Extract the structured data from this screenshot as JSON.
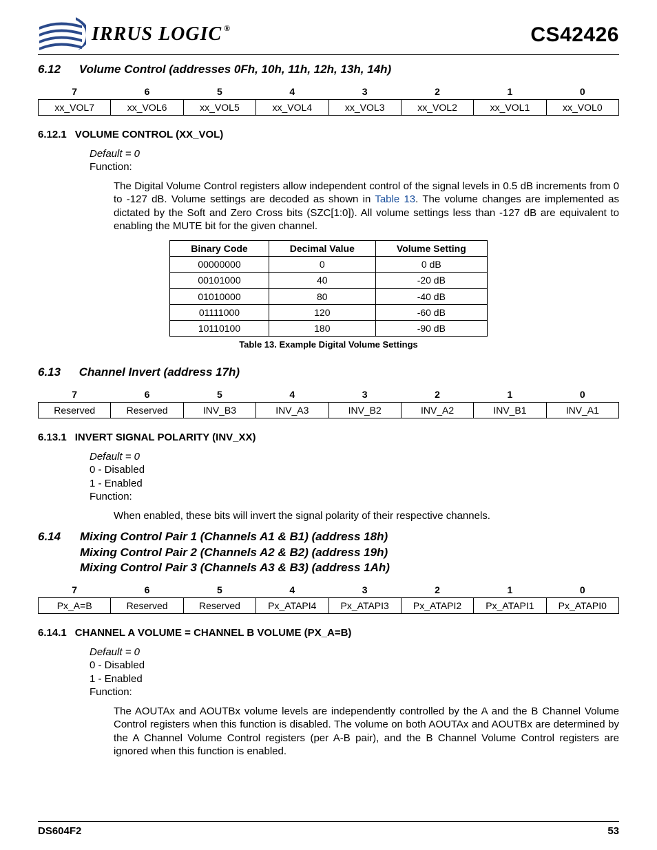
{
  "header": {
    "logo_text": "IRRUS LOGIC",
    "reg_mark": "®",
    "part_number": "CS42426"
  },
  "section612": {
    "number": "6.12",
    "title": "Volume Control (addresses 0Fh, 10h, 11h, 12h, 13h, 14h)",
    "bit_headers": [
      "7",
      "6",
      "5",
      "4",
      "3",
      "2",
      "1",
      "0"
    ],
    "bit_cells": [
      "xx_VOL7",
      "xx_VOL6",
      "xx_VOL5",
      "xx_VOL4",
      "xx_VOL3",
      "xx_VOL2",
      "xx_VOL1",
      "xx_VOL0"
    ],
    "sub": {
      "number": "6.12.1",
      "title": "VOLUME CONTROL (XX_VOL)",
      "default": "Default = 0",
      "function_label": "Function:",
      "text_a": "The Digital Volume Control registers allow independent control of the signal levels in 0.5 dB increments from 0 to -127 dB. Volume settings are decoded as shown in ",
      "link": "Table 13",
      "text_b": ". The volume changes are implemented as dictated by the Soft and Zero Cross bits (SZC[1:0]). All volume settings less than -127 dB are equivalent to enabling the MUTE bit for the given channel."
    },
    "vol_table": {
      "headers": [
        "Binary Code",
        "Decimal Value",
        "Volume Setting"
      ],
      "rows": [
        [
          "00000000",
          "0",
          "0 dB"
        ],
        [
          "00101000",
          "40",
          "-20 dB"
        ],
        [
          "01010000",
          "80",
          "-40 dB"
        ],
        [
          "01111000",
          "120",
          "-60 dB"
        ],
        [
          "10110100",
          "180",
          "-90 dB"
        ]
      ],
      "caption": "Table 13. Example Digital Volume Settings"
    }
  },
  "section613": {
    "number": "6.13",
    "title": "Channel Invert (address 17h)",
    "bit_headers": [
      "7",
      "6",
      "5",
      "4",
      "3",
      "2",
      "1",
      "0"
    ],
    "bit_cells": [
      "Reserved",
      "Reserved",
      "INV_B3",
      "INV_A3",
      "INV_B2",
      "INV_A2",
      "INV_B1",
      "INV_A1"
    ],
    "sub": {
      "number": "6.13.1",
      "title": "INVERT SIGNAL POLARITY (INV_XX)",
      "default": "Default = 0",
      "opt0": "0 - Disabled",
      "opt1": "1 - Enabled",
      "function_label": "Function:",
      "text": "When enabled, these bits will invert the signal polarity of their respective channels."
    }
  },
  "section614": {
    "number": "6.14",
    "title1": "Mixing Control Pair 1 (Channels A1 & B1) (address 18h)",
    "title2": "Mixing Control Pair 2 (Channels A2 & B2) (address 19h)",
    "title3": "Mixing Control Pair 3 (Channels A3 & B3) (address 1Ah)",
    "bit_headers": [
      "7",
      "6",
      "5",
      "4",
      "3",
      "2",
      "1",
      "0"
    ],
    "bit_cells": [
      "Px_A=B",
      "Reserved",
      "Reserved",
      "Px_ATAPI4",
      "Px_ATAPI3",
      "Px_ATAPI2",
      "Px_ATAPI1",
      "Px_ATAPI0"
    ],
    "sub": {
      "number": "6.14.1",
      "title": "CHANNEL A VOLUME = CHANNEL B VOLUME (PX_A=B)",
      "default": "Default = 0",
      "opt0": "0 - Disabled",
      "opt1": "1 - Enabled",
      "function_label": "Function:",
      "text": "The AOUTAx and AOUTBx volume levels are independently controlled by the A and the B Channel Volume Control registers when this function is disabled. The volume on both AOUTAx and AOUTBx are determined by the A Channel Volume Control registers (per A-B pair), and the B Channel Volume Control registers are ignored when this function is enabled."
    }
  },
  "footer": {
    "doc": "DS604F2",
    "page": "53"
  }
}
